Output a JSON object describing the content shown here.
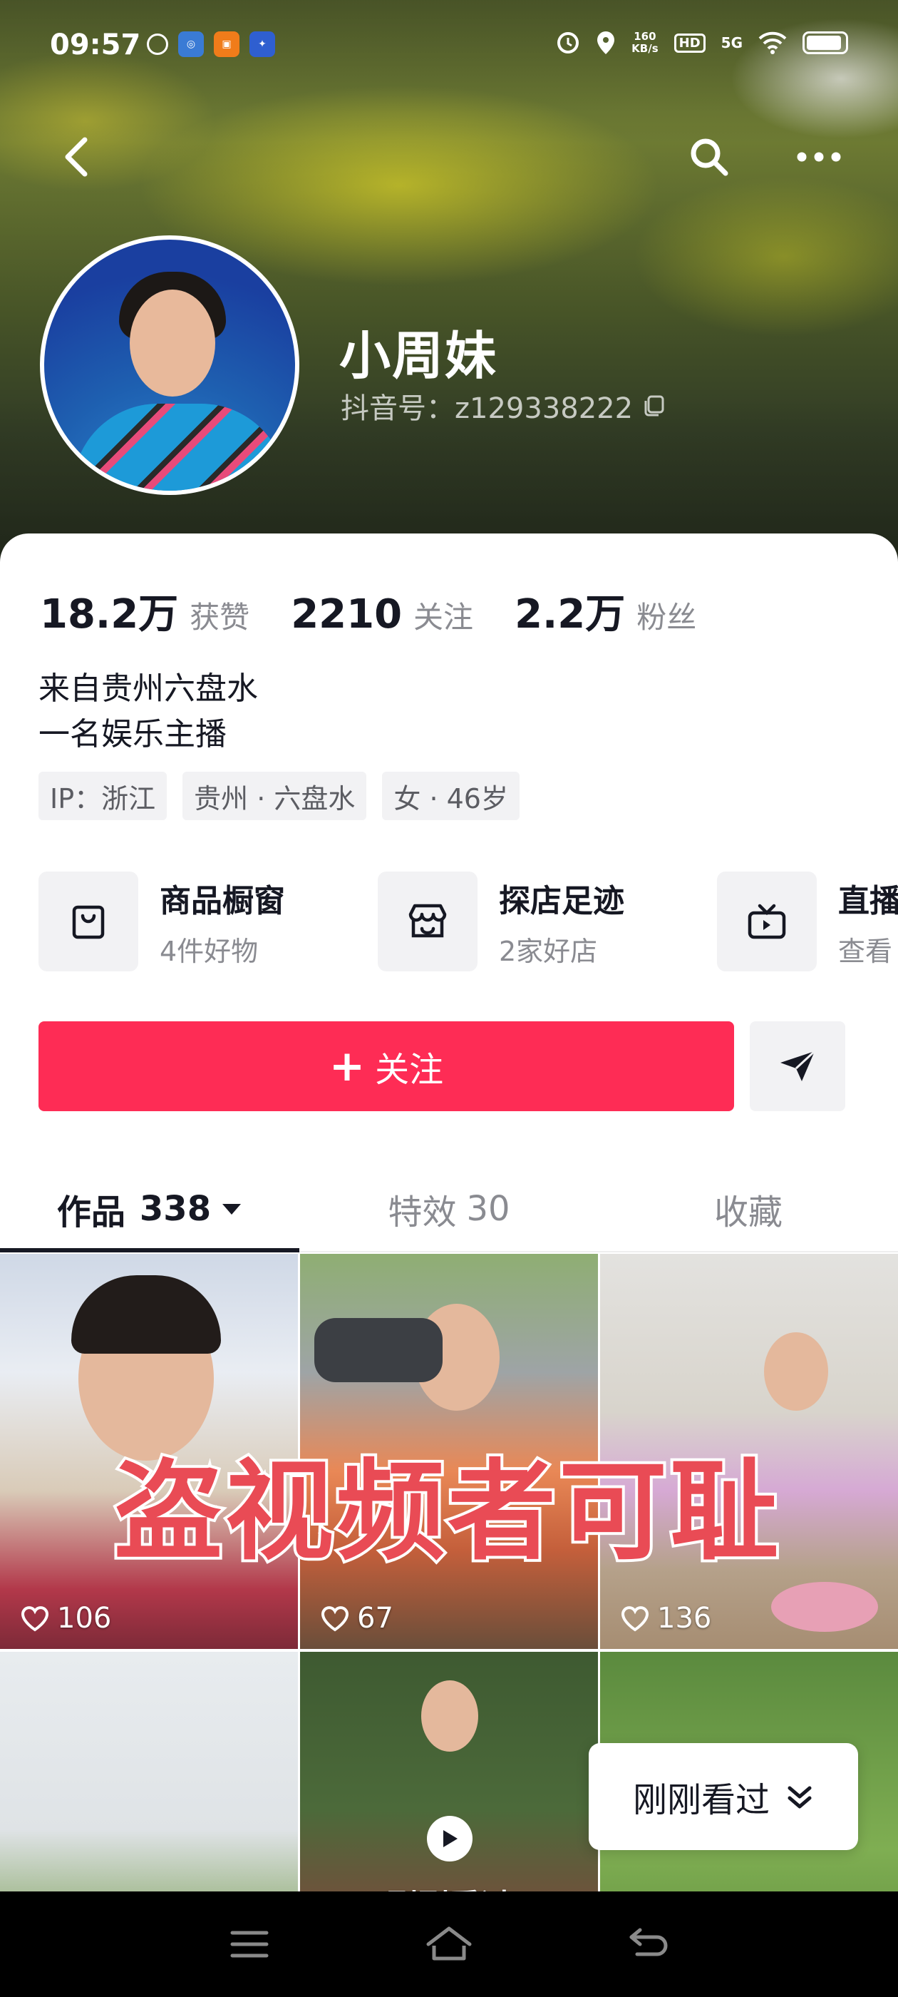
{
  "status_bar": {
    "time": "09:57",
    "net_speed_value": "160",
    "net_speed_unit": "KB/s",
    "hd": "HD",
    "network": "5G"
  },
  "profile": {
    "name": "小周妹",
    "douyin_id": "抖音号：z129338222"
  },
  "stats": [
    {
      "value": "18.2万",
      "label": "获赞"
    },
    {
      "value": "2210",
      "label": "关注"
    },
    {
      "value": "2.2万",
      "label": "粉丝"
    }
  ],
  "bio": {
    "line1": "来自贵州六盘水",
    "line2": "一名娱乐主播"
  },
  "tags": [
    "IP：浙江",
    "贵州 · 六盘水",
    "女 · 46岁"
  ],
  "features": [
    {
      "title": "商品橱窗",
      "sub": "4件好物",
      "icon": "shopping-bag-icon"
    },
    {
      "title": "探店足迹",
      "sub": "2家好店",
      "icon": "store-icon"
    },
    {
      "title": "直播",
      "sub": "查看",
      "icon": "tv-icon"
    }
  ],
  "actions": {
    "follow_label": "关注",
    "follow_color": "#fe2c55"
  },
  "tabs": [
    {
      "label": "作品",
      "count": "338"
    },
    {
      "label": "特效",
      "count": "30"
    },
    {
      "label": "收藏",
      "count": ""
    }
  ],
  "videos": [
    {
      "likes": "106"
    },
    {
      "likes": "67"
    },
    {
      "likes": "136"
    }
  ],
  "watermark_text": "盗视频者可耻",
  "just_watched_overlay": "刚刚看过",
  "recent_button_label": "刚刚看过"
}
